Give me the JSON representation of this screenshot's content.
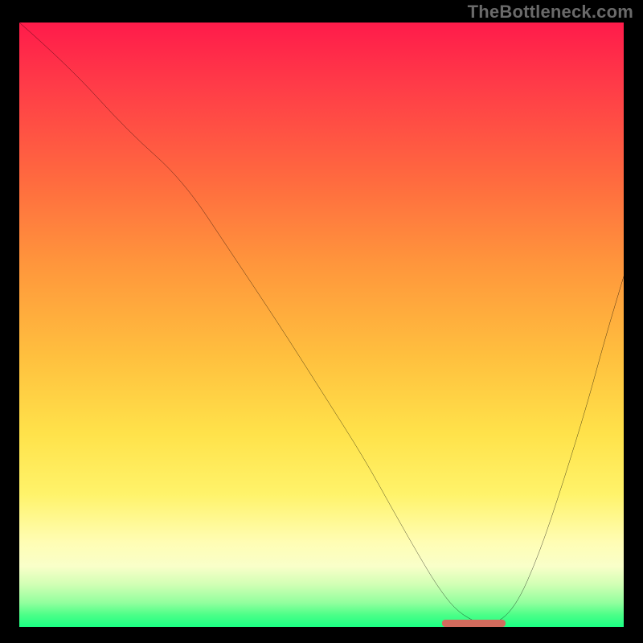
{
  "watermark": "TheBottleneck.com",
  "chart_data": {
    "type": "line",
    "title": "",
    "xlabel": "",
    "ylabel": "",
    "xlim": [
      0,
      100
    ],
    "ylim": [
      0,
      100
    ],
    "grid": false,
    "legend": false,
    "series": [
      {
        "name": "curve",
        "x": [
          0,
          8,
          18,
          27,
          35,
          43,
          50,
          57,
          62,
          66,
          69,
          72,
          75,
          78,
          82,
          86,
          90,
          94,
          97,
          100
        ],
        "y": [
          100,
          93,
          82,
          74,
          62,
          50,
          39,
          28,
          19,
          12,
          7,
          3,
          1,
          0,
          3,
          12,
          24,
          37,
          48,
          58
        ]
      }
    ],
    "annotations": [
      {
        "name": "min-marker",
        "x_start": 70,
        "x_end": 80.5,
        "y": 0.7,
        "color": "#d26b5d"
      }
    ],
    "background_gradient": {
      "orientation": "vertical",
      "stops": [
        {
          "pos": 0.0,
          "color": "#ff1b4a"
        },
        {
          "pos": 0.26,
          "color": "#ff6a3f"
        },
        {
          "pos": 0.55,
          "color": "#ffbf3e"
        },
        {
          "pos": 0.78,
          "color": "#fff36a"
        },
        {
          "pos": 0.93,
          "color": "#d1ffb4"
        },
        {
          "pos": 1.0,
          "color": "#1aff83"
        }
      ]
    }
  }
}
